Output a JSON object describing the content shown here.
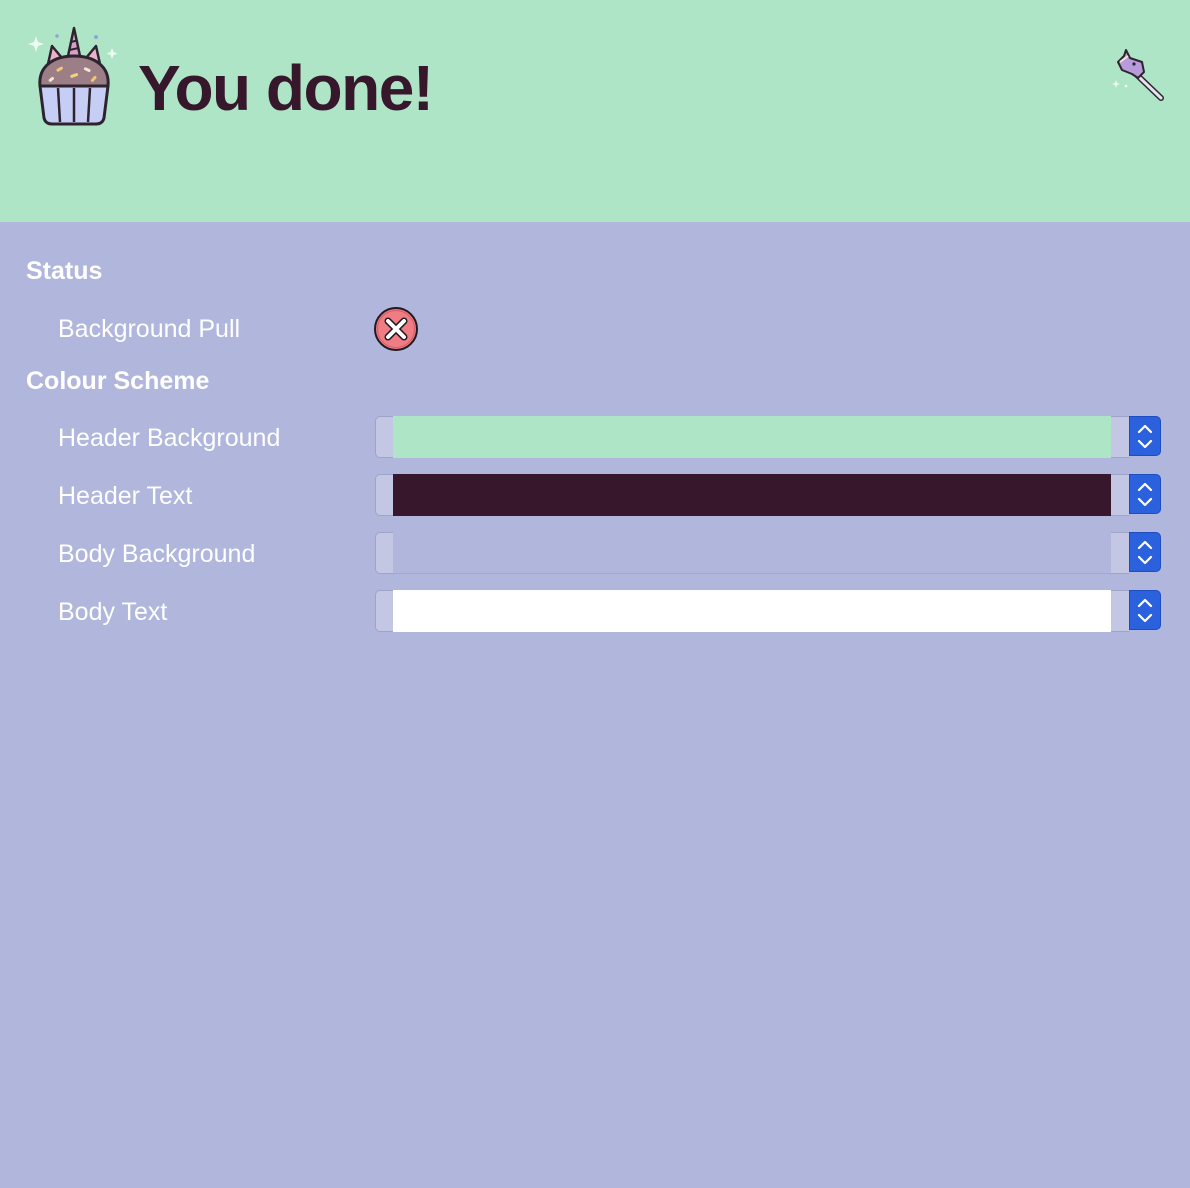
{
  "header": {
    "title": "You done!",
    "logo_icon": "unicorn-cupcake-icon",
    "wand_icon": "unicorn-wand-icon",
    "background_color": "#AFE5C7",
    "text_color": "#37172B"
  },
  "status": {
    "section_title": "Status",
    "rows": [
      {
        "label": "Background Pull",
        "state_icon": "error-x-circle-icon"
      }
    ]
  },
  "colour_scheme": {
    "section_title": "Colour Scheme",
    "rows": [
      {
        "label": "Header Background",
        "color": "#AFE5C7"
      },
      {
        "label": "Header Text",
        "color": "#37172B"
      },
      {
        "label": "Body Background",
        "color": "#B0B6DC"
      },
      {
        "label": "Body Text",
        "color": "#FFFFFF"
      }
    ]
  },
  "theme": {
    "body_background": "#B0B6DC",
    "body_text": "#FFFFFF",
    "accent": "#2C61DD",
    "error": "#F07C84"
  }
}
